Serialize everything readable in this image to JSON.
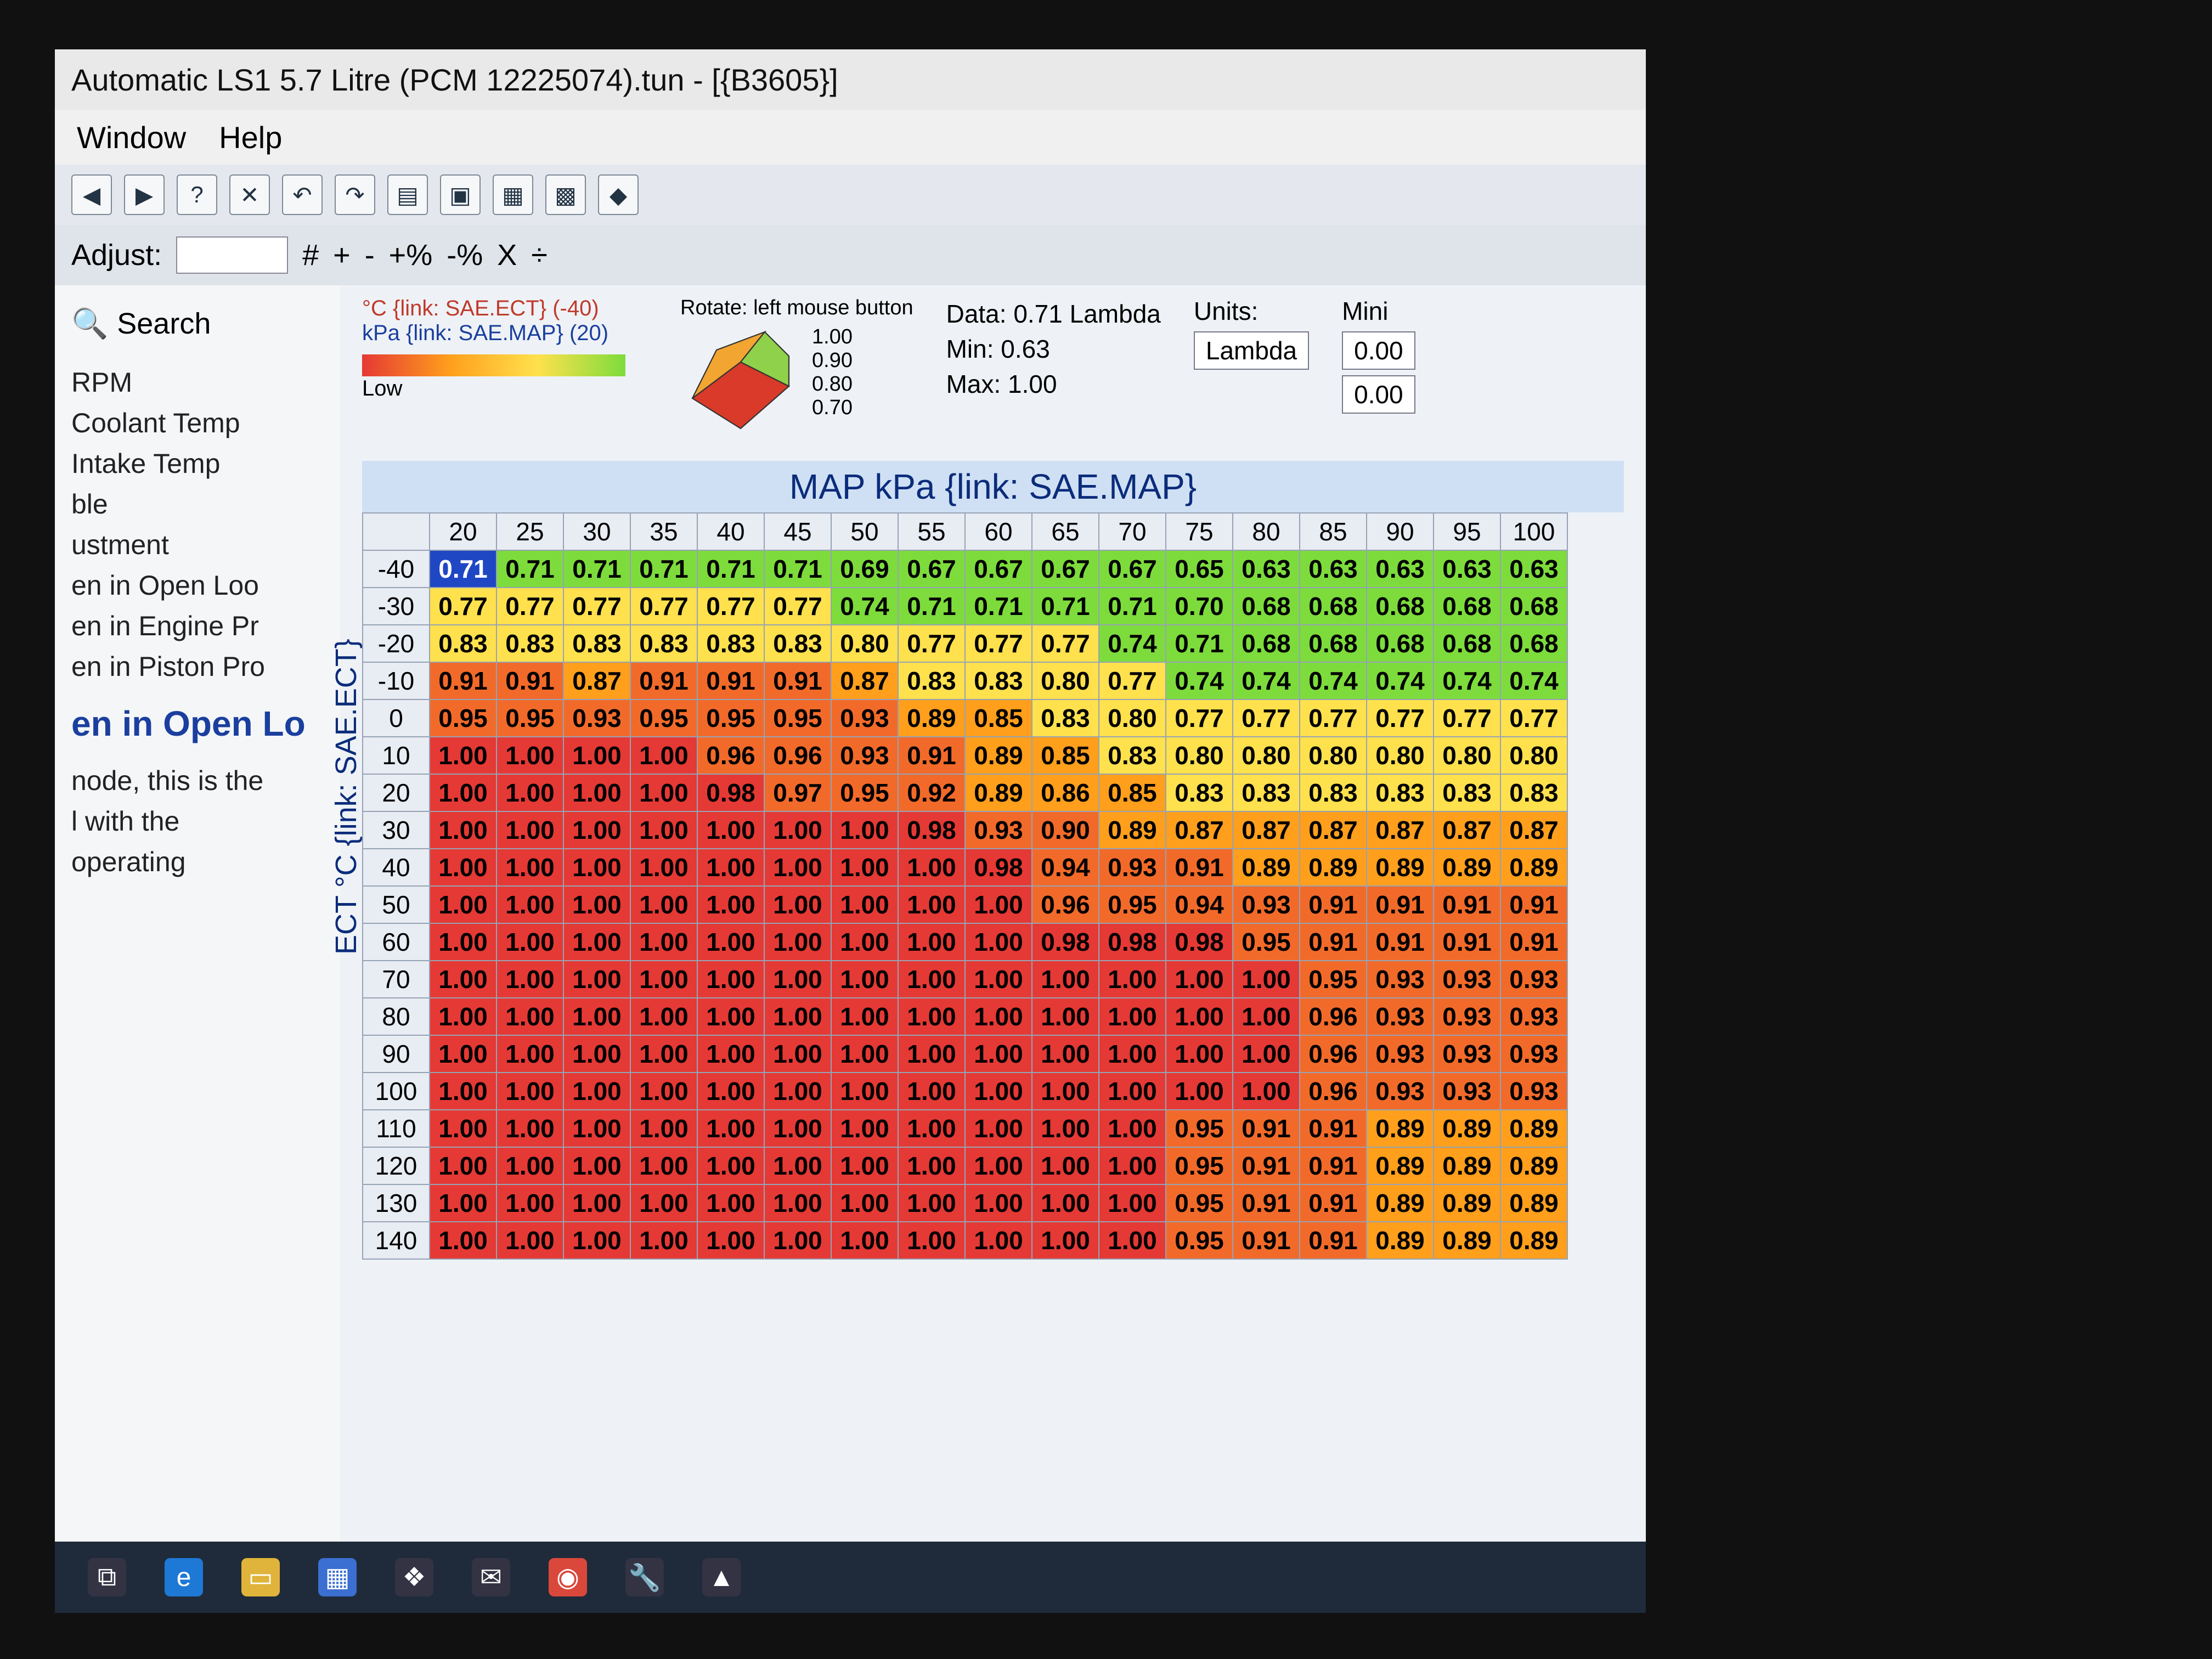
{
  "window": {
    "title": "Automatic LS1 5.7 Litre (PCM 12225074).tun - [{B3605}]"
  },
  "menu": [
    "Window",
    "Help"
  ],
  "toolbar2": {
    "adjust_label": "Adjust:",
    "ops": [
      "#",
      "+",
      "-",
      "+%",
      "-%",
      "X",
      "÷"
    ]
  },
  "sidebar": {
    "search_label": "Search",
    "items": [
      "RPM",
      "Coolant Temp",
      "Intake Temp",
      "ble",
      "ustment",
      "en in Open Loo",
      "en in Engine Pr",
      "en in Piston Pro"
    ],
    "heading": "en in Open Lo",
    "desc": [
      "node, this is the",
      "l with the",
      "operating"
    ]
  },
  "info": {
    "row_axis": "°C {link: SAE.ECT} (-40)",
    "col_axis": "kPa {link: SAE.MAP} (20)",
    "low_label": "Low",
    "rotate_label": "Rotate: left mouse button",
    "scale_values": [
      "1.00",
      "0.90",
      "0.80",
      "0.70"
    ],
    "data_label": "Data: 0.71 Lambda",
    "min_label": "Min: 0.63",
    "max_label": "Max: 1.00",
    "units_label": "Units:",
    "units_value": "Lambda",
    "mini_label": "Mini",
    "mini_values": [
      "0.00",
      "0.00"
    ]
  },
  "table": {
    "col_axis_title": "MAP kPa {link: SAE.MAP}",
    "row_axis_title": "ECT °C {link: SAE.ECT}",
    "columns": [
      "20",
      "25",
      "30",
      "35",
      "40",
      "45",
      "50",
      "55",
      "60",
      "65",
      "70",
      "75",
      "80",
      "85",
      "90",
      "95",
      "100"
    ],
    "rows": [
      {
        "h": "-40",
        "v": [
          "0.71",
          "0.71",
          "0.71",
          "0.71",
          "0.71",
          "0.71",
          "0.69",
          "0.67",
          "0.67",
          "0.67",
          "0.67",
          "0.65",
          "0.63",
          "0.63",
          "0.63",
          "0.63",
          "0.63"
        ]
      },
      {
        "h": "-30",
        "v": [
          "0.77",
          "0.77",
          "0.77",
          "0.77",
          "0.77",
          "0.77",
          "0.74",
          "0.71",
          "0.71",
          "0.71",
          "0.71",
          "0.70",
          "0.68",
          "0.68",
          "0.68",
          "0.68",
          "0.68"
        ]
      },
      {
        "h": "-20",
        "v": [
          "0.83",
          "0.83",
          "0.83",
          "0.83",
          "0.83",
          "0.83",
          "0.80",
          "0.77",
          "0.77",
          "0.77",
          "0.74",
          "0.71",
          "0.68",
          "0.68",
          "0.68",
          "0.68",
          "0.68"
        ]
      },
      {
        "h": "-10",
        "v": [
          "0.91",
          "0.91",
          "0.87",
          "0.91",
          "0.91",
          "0.91",
          "0.87",
          "0.83",
          "0.83",
          "0.80",
          "0.77",
          "0.74",
          "0.74",
          "0.74",
          "0.74",
          "0.74",
          "0.74"
        ]
      },
      {
        "h": "0",
        "v": [
          "0.95",
          "0.95",
          "0.93",
          "0.95",
          "0.95",
          "0.95",
          "0.93",
          "0.89",
          "0.85",
          "0.83",
          "0.80",
          "0.77",
          "0.77",
          "0.77",
          "0.77",
          "0.77",
          "0.77"
        ]
      },
      {
        "h": "10",
        "v": [
          "1.00",
          "1.00",
          "1.00",
          "1.00",
          "0.96",
          "0.96",
          "0.93",
          "0.91",
          "0.89",
          "0.85",
          "0.83",
          "0.80",
          "0.80",
          "0.80",
          "0.80",
          "0.80",
          "0.80"
        ]
      },
      {
        "h": "20",
        "v": [
          "1.00",
          "1.00",
          "1.00",
          "1.00",
          "0.98",
          "0.97",
          "0.95",
          "0.92",
          "0.89",
          "0.86",
          "0.85",
          "0.83",
          "0.83",
          "0.83",
          "0.83",
          "0.83",
          "0.83"
        ]
      },
      {
        "h": "30",
        "v": [
          "1.00",
          "1.00",
          "1.00",
          "1.00",
          "1.00",
          "1.00",
          "1.00",
          "0.98",
          "0.93",
          "0.90",
          "0.89",
          "0.87",
          "0.87",
          "0.87",
          "0.87",
          "0.87",
          "0.87"
        ]
      },
      {
        "h": "40",
        "v": [
          "1.00",
          "1.00",
          "1.00",
          "1.00",
          "1.00",
          "1.00",
          "1.00",
          "1.00",
          "0.98",
          "0.94",
          "0.93",
          "0.91",
          "0.89",
          "0.89",
          "0.89",
          "0.89",
          "0.89"
        ]
      },
      {
        "h": "50",
        "v": [
          "1.00",
          "1.00",
          "1.00",
          "1.00",
          "1.00",
          "1.00",
          "1.00",
          "1.00",
          "1.00",
          "0.96",
          "0.95",
          "0.94",
          "0.93",
          "0.91",
          "0.91",
          "0.91",
          "0.91"
        ]
      },
      {
        "h": "60",
        "v": [
          "1.00",
          "1.00",
          "1.00",
          "1.00",
          "1.00",
          "1.00",
          "1.00",
          "1.00",
          "1.00",
          "0.98",
          "0.98",
          "0.98",
          "0.95",
          "0.91",
          "0.91",
          "0.91",
          "0.91"
        ]
      },
      {
        "h": "70",
        "v": [
          "1.00",
          "1.00",
          "1.00",
          "1.00",
          "1.00",
          "1.00",
          "1.00",
          "1.00",
          "1.00",
          "1.00",
          "1.00",
          "1.00",
          "1.00",
          "0.95",
          "0.93",
          "0.93",
          "0.93"
        ]
      },
      {
        "h": "80",
        "v": [
          "1.00",
          "1.00",
          "1.00",
          "1.00",
          "1.00",
          "1.00",
          "1.00",
          "1.00",
          "1.00",
          "1.00",
          "1.00",
          "1.00",
          "1.00",
          "0.96",
          "0.93",
          "0.93",
          "0.93"
        ]
      },
      {
        "h": "90",
        "v": [
          "1.00",
          "1.00",
          "1.00",
          "1.00",
          "1.00",
          "1.00",
          "1.00",
          "1.00",
          "1.00",
          "1.00",
          "1.00",
          "1.00",
          "1.00",
          "0.96",
          "0.93",
          "0.93",
          "0.93"
        ]
      },
      {
        "h": "100",
        "v": [
          "1.00",
          "1.00",
          "1.00",
          "1.00",
          "1.00",
          "1.00",
          "1.00",
          "1.00",
          "1.00",
          "1.00",
          "1.00",
          "1.00",
          "1.00",
          "0.96",
          "0.93",
          "0.93",
          "0.93"
        ]
      },
      {
        "h": "110",
        "v": [
          "1.00",
          "1.00",
          "1.00",
          "1.00",
          "1.00",
          "1.00",
          "1.00",
          "1.00",
          "1.00",
          "1.00",
          "1.00",
          "0.95",
          "0.91",
          "0.91",
          "0.89",
          "0.89",
          "0.89"
        ]
      },
      {
        "h": "120",
        "v": [
          "1.00",
          "1.00",
          "1.00",
          "1.00",
          "1.00",
          "1.00",
          "1.00",
          "1.00",
          "1.00",
          "1.00",
          "1.00",
          "0.95",
          "0.91",
          "0.91",
          "0.89",
          "0.89",
          "0.89"
        ]
      },
      {
        "h": "130",
        "v": [
          "1.00",
          "1.00",
          "1.00",
          "1.00",
          "1.00",
          "1.00",
          "1.00",
          "1.00",
          "1.00",
          "1.00",
          "1.00",
          "0.95",
          "0.91",
          "0.91",
          "0.89",
          "0.89",
          "0.89"
        ]
      },
      {
        "h": "140",
        "v": [
          "1.00",
          "1.00",
          "1.00",
          "1.00",
          "1.00",
          "1.00",
          "1.00",
          "1.00",
          "1.00",
          "1.00",
          "1.00",
          "0.95",
          "0.91",
          "0.91",
          "0.89",
          "0.89",
          "0.89"
        ]
      }
    ]
  },
  "colors": {
    "high": "#e53935",
    "mid": "#ff9f1c",
    "low_mid": "#ffe14d",
    "low": "#7ddc3c",
    "selected": "#1f47c4"
  },
  "taskbar_icons": [
    "task-view-icon",
    "edge-icon",
    "explorer-icon",
    "store-icon",
    "dropbox-icon",
    "mail-icon",
    "chrome-icon",
    "tool-icon",
    "app-icon"
  ]
}
